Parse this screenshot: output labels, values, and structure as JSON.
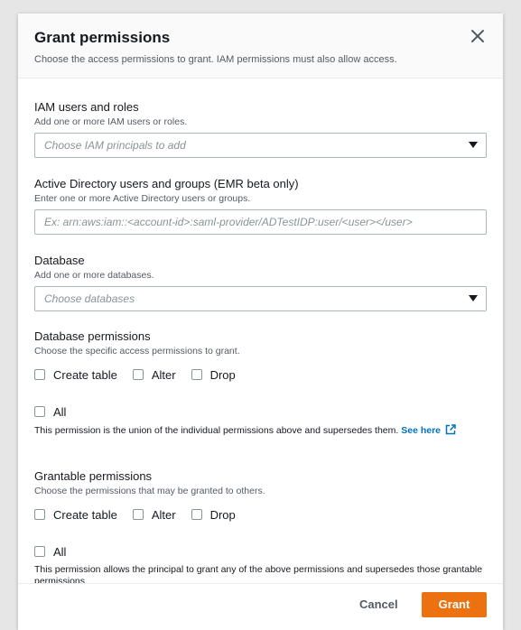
{
  "modal": {
    "title": "Grant permissions",
    "subtitle": "Choose the access permissions to grant. IAM permissions must also allow access."
  },
  "iam": {
    "label": "IAM users and roles",
    "description": "Add one or more IAM users or roles.",
    "placeholder": "Choose IAM principals to add"
  },
  "active_directory": {
    "label": "Active Directory users and groups (EMR beta only)",
    "description": "Enter one or more Active Directory users or groups.",
    "placeholder": "Ex: arn:aws:iam::<account-id>:saml-provider/ADTestIDP:user/<user></user>"
  },
  "database": {
    "label": "Database",
    "description": "Add one or more databases.",
    "placeholder": "Choose databases"
  },
  "database_permissions": {
    "label": "Database permissions",
    "description": "Choose the specific access permissions to grant.",
    "options": [
      "Create table",
      "Alter",
      "Drop"
    ],
    "all_label": "All",
    "note": "This permission is the union of the individual permissions above and supersedes them.",
    "link_text": "See here"
  },
  "grantable_permissions": {
    "label": "Grantable permissions",
    "description": "Choose the permissions that may be granted to others.",
    "options": [
      "Create table",
      "Alter",
      "Drop"
    ],
    "all_label": "All",
    "note": "This permission allows the principal to grant any of the above permissions and supersedes those grantable permissions."
  },
  "footer": {
    "cancel_label": "Cancel",
    "grant_label": "Grant"
  },
  "colors": {
    "primary_button": "#ec7211",
    "link": "#0073bb"
  },
  "icons": {
    "close": "close-icon",
    "dropdown": "caret-down-icon",
    "external_link": "external-link-icon"
  }
}
